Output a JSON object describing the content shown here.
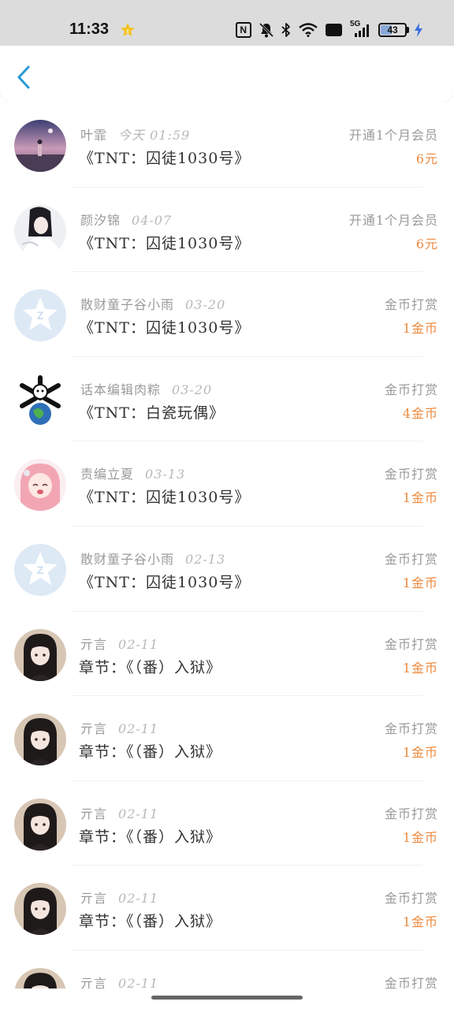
{
  "status_bar": {
    "time": "11:33",
    "battery": "43",
    "hd_label": "HD",
    "network_label": "5G",
    "nfc_label": "N",
    "icons": [
      "star-badge-icon",
      "nfc-icon",
      "bell-muted-icon",
      "bluetooth-icon",
      "wifi-icon",
      "hd-icon",
      "signal-5g-icon",
      "battery-icon",
      "charging-icon"
    ]
  },
  "header": {
    "back_icon": "chevron-left-icon",
    "accent_color": "#2a9ad6"
  },
  "colors": {
    "amount": "#ee8a3e",
    "meta": "#9a9a9a",
    "title": "#333333"
  },
  "records": [
    {
      "name": "叶霏",
      "date": "今天 01:59",
      "title": "《TNT：囚徒1030号》",
      "type": "开通1个月会员",
      "amount": "6元",
      "avatar": "anime-sky"
    },
    {
      "name": "颜汐锦",
      "date": "04-07",
      "title": "《TNT：囚徒1030号》",
      "type": "开通1个月会员",
      "amount": "6元",
      "avatar": "anime-white"
    },
    {
      "name": "散财童子谷小雨",
      "date": "03-20",
      "title": "《TNT：囚徒1030号》",
      "type": "金币打赏",
      "amount": "1金币",
      "avatar": "default-z"
    },
    {
      "name": "话本编辑肉粽",
      "date": "03-20",
      "title": "《TNT：白瓷玩偶》",
      "type": "金币打赏",
      "amount": "4金币",
      "avatar": "earth-bones"
    },
    {
      "name": "责编立夏",
      "date": "03-13",
      "title": "《TNT：囚徒1030号》",
      "type": "金币打赏",
      "amount": "1金币",
      "avatar": "anime-pink"
    },
    {
      "name": "散财童子谷小雨",
      "date": "02-13",
      "title": "《TNT：囚徒1030号》",
      "type": "金币打赏",
      "amount": "1金币",
      "avatar": "default-z"
    },
    {
      "name": "亓言",
      "date": "02-11",
      "title": "章节：《（番）入狱》",
      "type": "金币打赏",
      "amount": "1金币",
      "avatar": "anime-dark"
    },
    {
      "name": "亓言",
      "date": "02-11",
      "title": "章节：《（番）入狱》",
      "type": "金币打赏",
      "amount": "1金币",
      "avatar": "anime-dark"
    },
    {
      "name": "亓言",
      "date": "02-11",
      "title": "章节：《（番）入狱》",
      "type": "金币打赏",
      "amount": "1金币",
      "avatar": "anime-dark"
    },
    {
      "name": "亓言",
      "date": "02-11",
      "title": "章节：《（番）入狱》",
      "type": "金币打赏",
      "amount": "1金币",
      "avatar": "anime-dark"
    },
    {
      "name": "亓言",
      "date": "02-11",
      "title": "",
      "type": "金币打赏",
      "amount": "",
      "avatar": "anime-dark"
    }
  ]
}
